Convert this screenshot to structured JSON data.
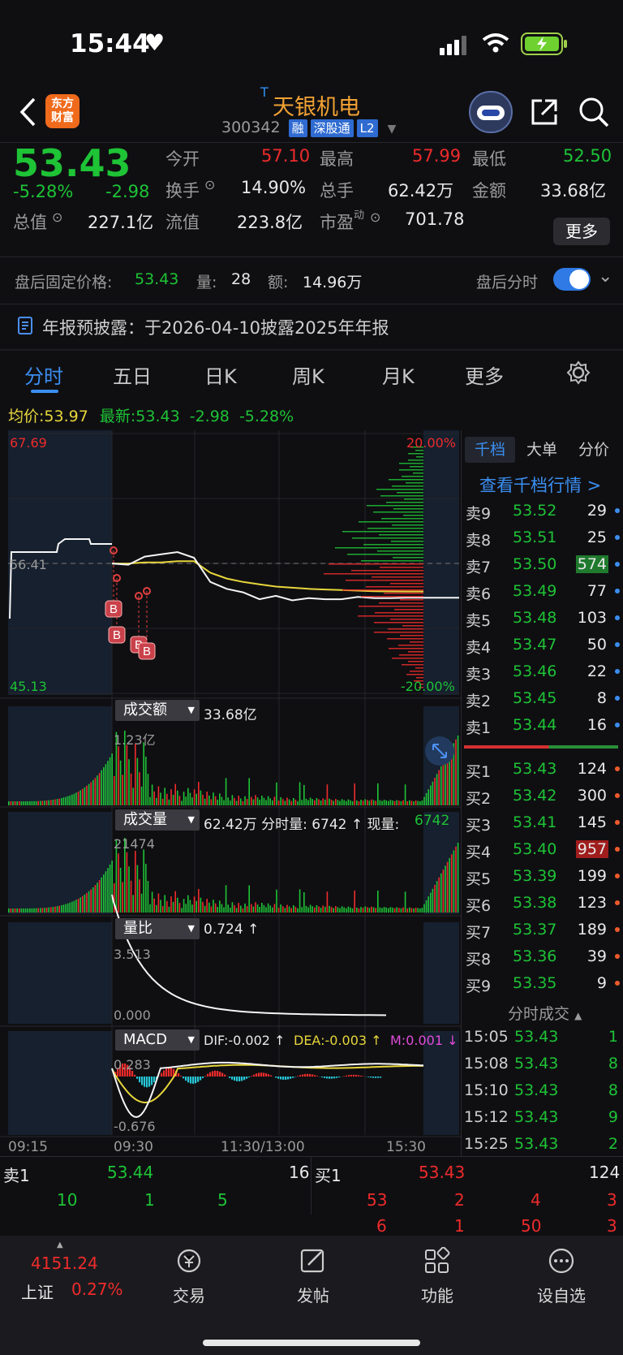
{
  "status": {
    "time": "15:44"
  },
  "header": {
    "logo_line1": "东方",
    "logo_line2": "财富",
    "stock_name": "天银机电",
    "stock_code": "300342",
    "tag_margin": "融",
    "tag_connect": "深股通",
    "tag_level": "L2"
  },
  "quote": {
    "price": "53.43",
    "change_pct": "-5.28%",
    "change": "-2.98",
    "open_label": "今开",
    "open": "57.10",
    "high_label": "最高",
    "high": "57.99",
    "low_label": "最低",
    "low": "52.50",
    "turnover_label": "换手",
    "turnover": "14.90%",
    "volume_label": "总手",
    "volume": "62.42万",
    "amount_label": "金额",
    "amount": "33.68亿",
    "mcap_label": "总值",
    "mcap": "227.1亿",
    "float_label": "流值",
    "float": "223.8亿",
    "pe_label": "市盈",
    "pe_sup": "动",
    "pe": "701.78",
    "more": "更多"
  },
  "afterhours": {
    "label": "盘后固定价格:",
    "price": "53.43",
    "qty_label": "量:",
    "qty": "28",
    "amt_label": "额:",
    "amt": "14.96万",
    "toggle_label": "盘后分时"
  },
  "notice": {
    "text": "年报预披露：于2026-04-10披露2025年年报"
  },
  "tabs": [
    "分时",
    "五日",
    "日K",
    "周K",
    "月K",
    "更多"
  ],
  "chart_info": {
    "avg_label": "均价:",
    "avg": "53.97",
    "last_label": "最新:",
    "last": "53.43",
    "chg": "-2.98",
    "pct": "-5.28%"
  },
  "chart_data": {
    "type": "line",
    "y_max": "67.69",
    "y_mid": "56.41",
    "y_min": "45.13",
    "pct_max": "20.00%",
    "pct_min": "-20.00%",
    "ylim": [
      45.13,
      67.69
    ],
    "x_ticks": [
      "09:15",
      "09:30",
      "11:30/13:00",
      "15:30"
    ],
    "markers": [
      "B",
      "B",
      "B",
      "B"
    ],
    "amount_label": "成交额",
    "amount_total": "33.68亿",
    "amount_peak": "1.23亿",
    "vol_label": "成交量",
    "vol_info": "62.42万 分时量: 6742 ↑ 现量:",
    "vol_now": "6742",
    "vol_peak": "21474",
    "ratio_label": "量比",
    "ratio_val": "0.724 ↑",
    "ratio_peak": "3.513",
    "ratio_zero": "0.000",
    "macd_label": "MACD",
    "dif": "DIF:-0.002 ↑",
    "dea": "DEA:-0.003 ↑",
    "m": "M:0.001 ↓",
    "macd_top": "0.283",
    "macd_bot": "-0.676",
    "price_series": [
      56.4,
      56.3,
      57.0,
      57.2,
      57.4,
      56.9,
      54.8,
      54.2,
      53.9,
      53.3,
      53.6,
      53.2,
      53.4,
      53.3,
      53.3,
      53.5,
      53.4,
      53.4,
      53.43,
      53.43
    ],
    "avg_series": [
      56.4,
      56.4,
      56.5,
      56.5,
      56.6,
      56.6,
      55.6,
      55.1,
      54.8,
      54.6,
      54.4,
      54.3,
      54.2,
      54.15,
      54.1,
      54.05,
      54.0,
      53.98,
      53.97,
      53.97
    ]
  },
  "orderbook": {
    "tabs": [
      "千档",
      "大单",
      "分价"
    ],
    "link": "查看千档行情 >",
    "asks": [
      {
        "label": "卖9",
        "price": "53.52",
        "qty": "29"
      },
      {
        "label": "卖8",
        "price": "53.51",
        "qty": "25"
      },
      {
        "label": "卖7",
        "price": "53.50",
        "qty": "574"
      },
      {
        "label": "卖6",
        "price": "53.49",
        "qty": "77"
      },
      {
        "label": "卖5",
        "price": "53.48",
        "qty": "103"
      },
      {
        "label": "卖4",
        "price": "53.47",
        "qty": "50"
      },
      {
        "label": "卖3",
        "price": "53.46",
        "qty": "22"
      },
      {
        "label": "卖2",
        "price": "53.45",
        "qty": "8"
      },
      {
        "label": "卖1",
        "price": "53.44",
        "qty": "16"
      }
    ],
    "bids": [
      {
        "label": "买1",
        "price": "53.43",
        "qty": "124"
      },
      {
        "label": "买2",
        "price": "53.42",
        "qty": "300"
      },
      {
        "label": "买3",
        "price": "53.41",
        "qty": "145"
      },
      {
        "label": "买4",
        "price": "53.40",
        "qty": "957"
      },
      {
        "label": "买5",
        "price": "53.39",
        "qty": "199"
      },
      {
        "label": "买6",
        "price": "53.38",
        "qty": "123"
      },
      {
        "label": "买7",
        "price": "53.37",
        "qty": "189"
      },
      {
        "label": "买8",
        "price": "53.36",
        "qty": "39"
      },
      {
        "label": "买9",
        "price": "53.35",
        "qty": "9"
      }
    ],
    "trades_title": "分时成交",
    "trades": [
      {
        "t": "15:05",
        "p": "53.43",
        "v": "1"
      },
      {
        "t": "15:08",
        "p": "53.43",
        "v": "8"
      },
      {
        "t": "15:10",
        "p": "53.43",
        "v": "8"
      },
      {
        "t": "15:12",
        "p": "53.43",
        "v": "9"
      },
      {
        "t": "15:25",
        "p": "53.43",
        "v": "2"
      }
    ]
  },
  "bottom_book": {
    "sell_label": "卖1",
    "sell_price": "53.44",
    "sell_qty": "16",
    "buy_label": "买1",
    "buy_price": "53.43",
    "buy_qty": "124",
    "sell_lots": [
      "10",
      "1",
      "5"
    ],
    "buy_lots_1": [
      "53",
      "2",
      "4",
      "3"
    ],
    "buy_lots_2": [
      "6",
      "1",
      "50",
      "3"
    ]
  },
  "nav": {
    "index_value": "4151.24",
    "index_name": "上证",
    "index_pct": "0.27%",
    "items": [
      "交易",
      "发帖",
      "功能",
      "设自选"
    ]
  }
}
